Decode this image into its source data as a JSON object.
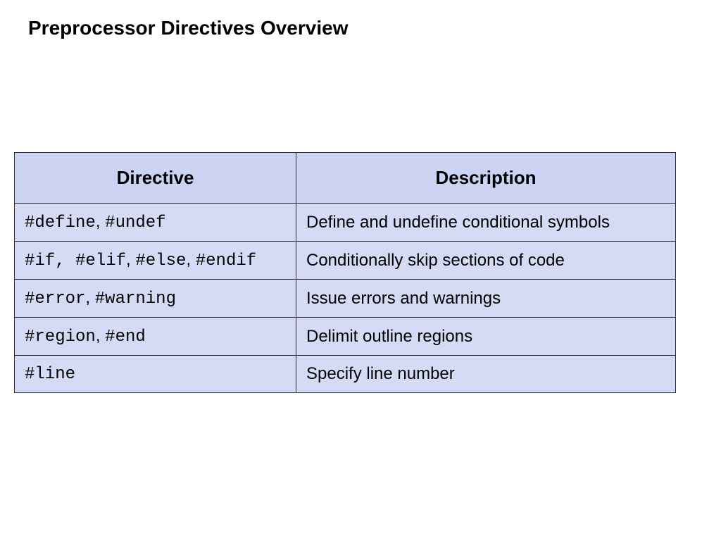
{
  "title": "Preprocessor Directives Overview",
  "headers": {
    "col0": "Directive",
    "col1": "Description"
  },
  "rows": [
    {
      "directive_html": "<span class='code'>#define</span><span class='sep'>, </span><span class='code'>#undef</span>",
      "description": "Define and undefine conditional symbols"
    },
    {
      "directive_html": "<span class='code'>#if, #elif</span><span class='sep'>, </span><span class='code'>#else</span><span class='sep'>, </span><span class='code'>#endif</span>",
      "description": "Conditionally skip sections of code"
    },
    {
      "directive_html": "<span class='code'>#error</span><span class='sep'>, </span><span class='code'>#warning</span>",
      "description": "Issue errors and warnings"
    },
    {
      "directive_html": "<span class='code'>#region</span><span class='sep'>, </span><span class='code'>#end</span>",
      "description": "Delimit outline regions"
    },
    {
      "directive_html": "<span class='code'>#line</span>",
      "description": "Specify line number"
    }
  ]
}
